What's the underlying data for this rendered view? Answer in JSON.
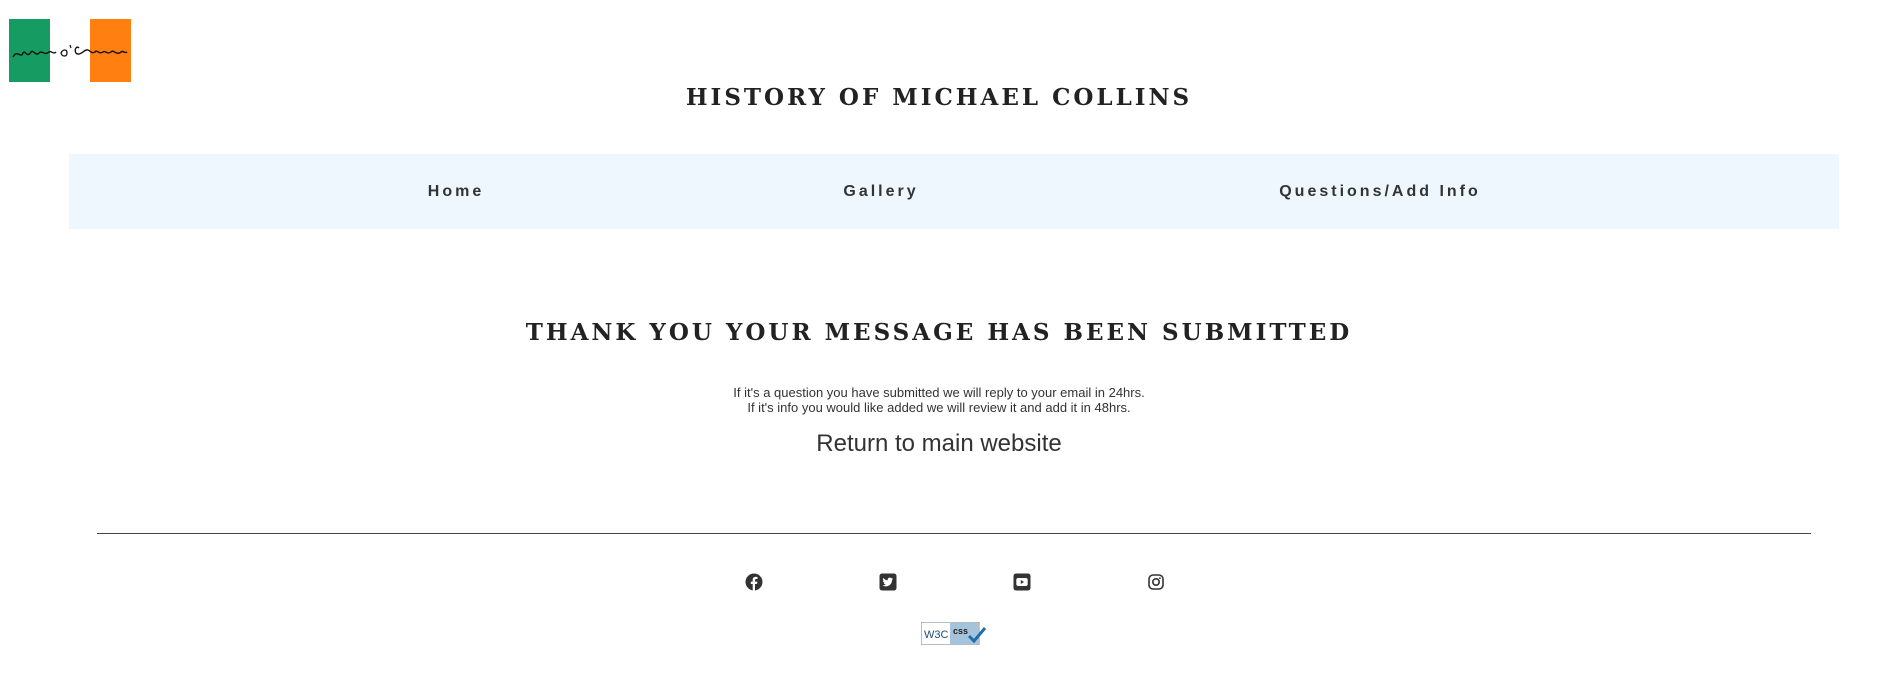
{
  "logo": {
    "signature_text": "Mícheál Ó Coileáin",
    "colors": {
      "green": "#169b62",
      "white": "#ffffff",
      "orange": "#ff7f11"
    }
  },
  "header": {
    "title": "HISTORY OF MICHAEL COLLINS"
  },
  "nav": {
    "background": "#eef7fd",
    "items": [
      {
        "label": "Home"
      },
      {
        "label": "Gallery"
      },
      {
        "label": "Questions/Add Info"
      }
    ]
  },
  "main": {
    "heading": "THANK YOU YOUR MESSAGE HAS BEEN SUBMITTED",
    "info_lines": [
      "If it's a question you have submitted we will reply to your email in 24hrs.",
      "If it's info you would like added we will review it and add it in 48hrs."
    ],
    "return_link": "Return to main website"
  },
  "footer": {
    "social": [
      {
        "icon": "facebook-icon"
      },
      {
        "icon": "twitter-icon"
      },
      {
        "icon": "youtube-icon"
      },
      {
        "icon": "instagram-icon"
      }
    ],
    "badge": {
      "icon": "w3c-css-valid-badge",
      "text_w3c": "W3C",
      "text_css": "css"
    }
  }
}
